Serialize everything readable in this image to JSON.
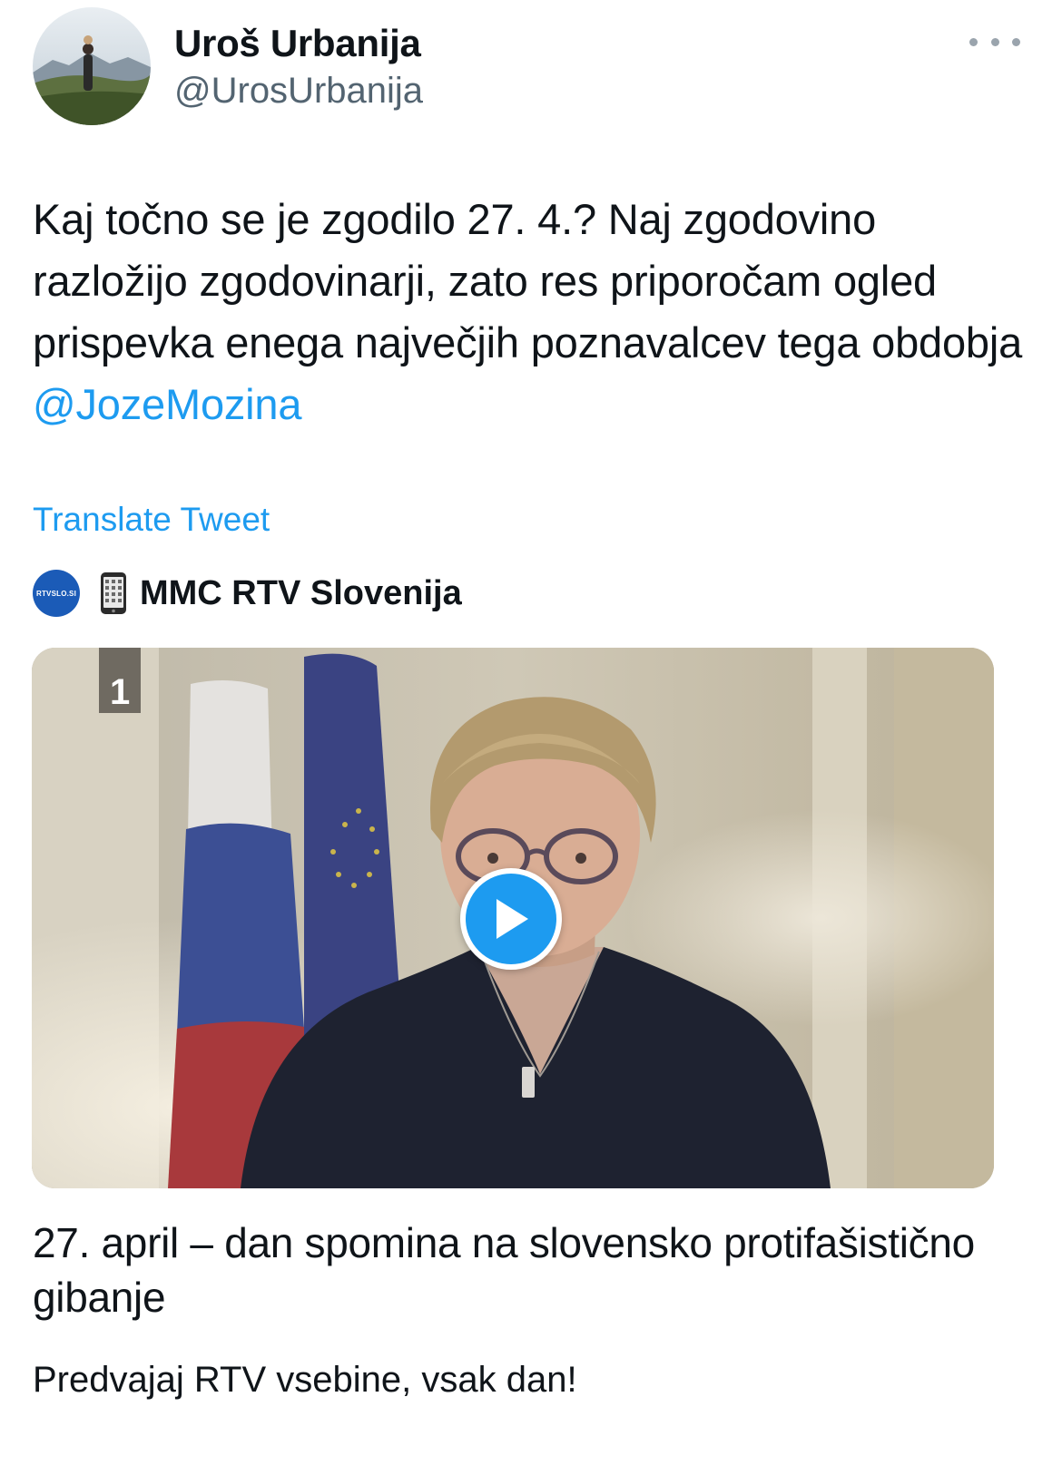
{
  "author": {
    "display_name": "Uroš Urbanija",
    "handle": "@UrosUrbanija"
  },
  "tweet": {
    "text": "Kaj točno se je zgodilo 27. 4.? Naj zgodovino razložijo zgodovinarji, zato res priporočam ogled prispevka enega največjih poznavalcev tega obdobja ",
    "mention": "@JozeMozina",
    "translate_label": "Translate Tweet"
  },
  "card": {
    "source_logo_text": "RTVSLO.SI",
    "source_name": "MMC RTV Slovenija",
    "channel_badge": "1",
    "title": "27. april – dan spomina na slovensko protifašistično gibanje",
    "description": "Predvajaj RTV vsebine, vsak dan!"
  },
  "icons": {
    "more": "more-horizontal-icon",
    "play": "play-icon",
    "phone": "mobile-phone-icon"
  },
  "colors": {
    "accent": "#1d9bf0",
    "text": "#0f1419",
    "secondary": "#536471"
  }
}
